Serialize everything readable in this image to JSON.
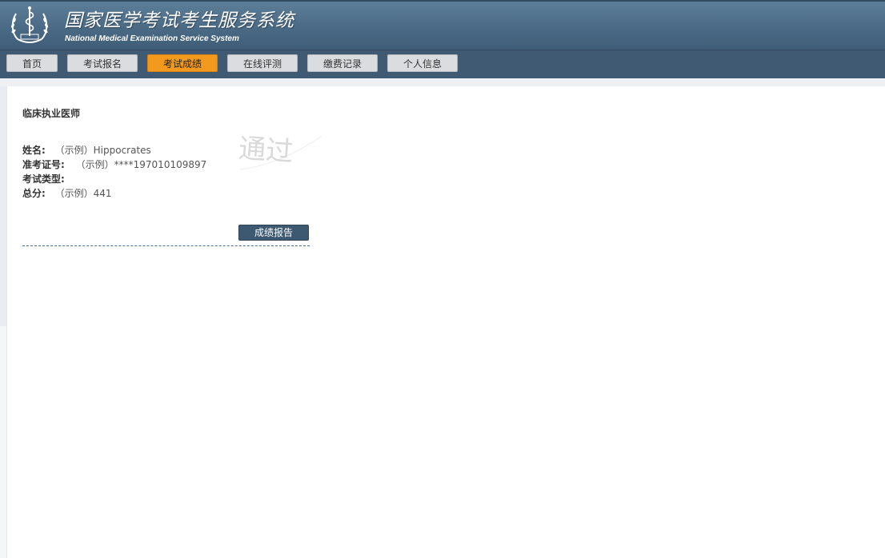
{
  "header": {
    "title_cn": "国家医学考试考生服务系统",
    "title_en": "National Medical Examination Service System"
  },
  "nav": {
    "items": [
      {
        "label": "首页",
        "active": false
      },
      {
        "label": "考试报名",
        "active": false
      },
      {
        "label": "考试成绩",
        "active": true
      },
      {
        "label": "在线评测",
        "active": false
      },
      {
        "label": "缴费记录",
        "active": false
      },
      {
        "label": "个人信息",
        "active": false
      }
    ]
  },
  "result": {
    "exam_type_title": "临床执业医师",
    "name_label": "姓名:",
    "name_value": "（示例）Hippocrates",
    "ticket_label": "准考证号:",
    "ticket_value": "（示例）****197010109897",
    "type_label": "考试类型:",
    "type_value": "",
    "score_label": "总分:",
    "score_value": "（示例）441",
    "stamp_text": "通过",
    "report_button": "成绩报告"
  },
  "colors": {
    "active_tab": "#f39a1e",
    "header_bg": "#4a6a85",
    "button_bg": "#3d5871"
  }
}
